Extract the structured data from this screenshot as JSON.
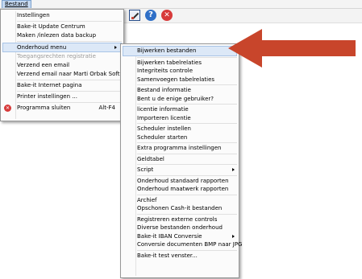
{
  "menubar": {
    "bestand": "Bestand"
  },
  "toolbar": {
    "help_glyph": "?",
    "close_glyph": "✕"
  },
  "main_menu": {
    "items": [
      {
        "label": "Instellingen"
      },
      {
        "label": "Bake-it Update Centrum"
      },
      {
        "label": "Maken /inlezen data backup"
      },
      {
        "label": "Onderhoud menu"
      },
      {
        "label": "Toegangsrechten registratie"
      },
      {
        "label": "Verzend een email"
      },
      {
        "label": "Verzend email naar Marti Orbak Software"
      },
      {
        "label": "Bake-it Internet pagina"
      },
      {
        "label": "Printer instellingen ..."
      },
      {
        "label": "Programma sluiten",
        "shortcut": "Alt-F4"
      }
    ]
  },
  "sub_menu": {
    "items": [
      {
        "label": "Bijwerken bestanden"
      },
      {
        "label": "Bijwerken tabelrelaties"
      },
      {
        "label": "Integriteits controle"
      },
      {
        "label": "Samenvoegen tabelrelaties"
      },
      {
        "label": "Bestand informatie"
      },
      {
        "label": "Bent u de enige gebruiker?"
      },
      {
        "label": "licentie informatie"
      },
      {
        "label": "Importeren licentie"
      },
      {
        "label": "Scheduler instellen"
      },
      {
        "label": "Scheduler starten"
      },
      {
        "label": "Extra programma instellingen"
      },
      {
        "label": "Geldtabel"
      },
      {
        "label": "Script"
      },
      {
        "label": "Onderhoud standaard rapporten"
      },
      {
        "label": "Onderhoud maatwerk rapporten"
      },
      {
        "label": "Archief"
      },
      {
        "label": "Opschonen Cash-it bestanden"
      },
      {
        "label": "Registreren externe controls"
      },
      {
        "label": "Diverse bestanden onderhoud"
      },
      {
        "label": "Bake-it IBAN Conversie"
      },
      {
        "label": "Conversie documenten BMP naar JPG"
      },
      {
        "label": "Bake-it test venster..."
      }
    ]
  },
  "colors": {
    "pointer_arrow": "#c8452b",
    "highlight": "#dce8f7"
  }
}
